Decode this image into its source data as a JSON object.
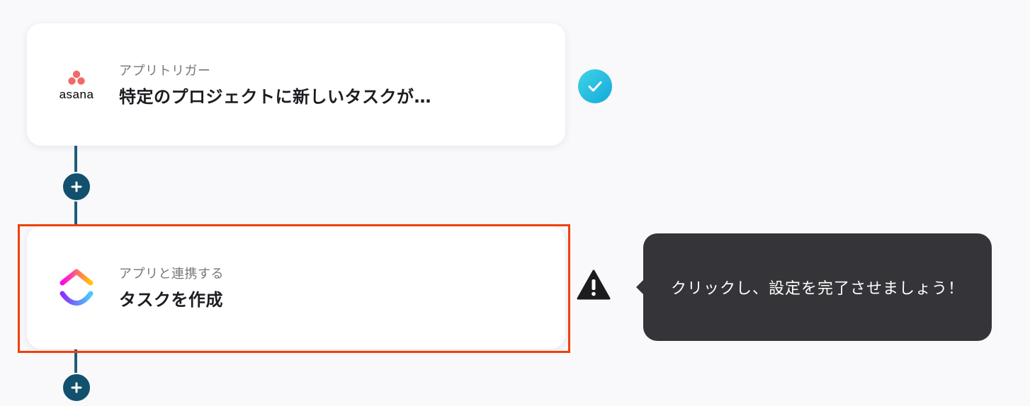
{
  "workflow": {
    "steps": [
      {
        "app": "asana",
        "logo_text": "asana",
        "label": "アプリトリガー",
        "title": "特定のプロジェクトに新しいタスクが…",
        "status": "completed",
        "status_icon": "check-icon"
      },
      {
        "app": "clickup",
        "label": "アプリと連携する",
        "title": "タスクを作成",
        "status": "warning",
        "status_icon": "warning-icon"
      }
    ],
    "add_step_icon": "plus-icon"
  },
  "tooltip": {
    "text": "クリックし、設定を完了させましょう！"
  },
  "colors": {
    "background": "#f9f8fb",
    "connector": "#1e5d7a",
    "add_button": "#12506e",
    "highlight_border": "#f0400a",
    "check_badge": "#14a9dc",
    "tooltip_bg": "#353438",
    "asana_brand": "#f06a6a"
  }
}
